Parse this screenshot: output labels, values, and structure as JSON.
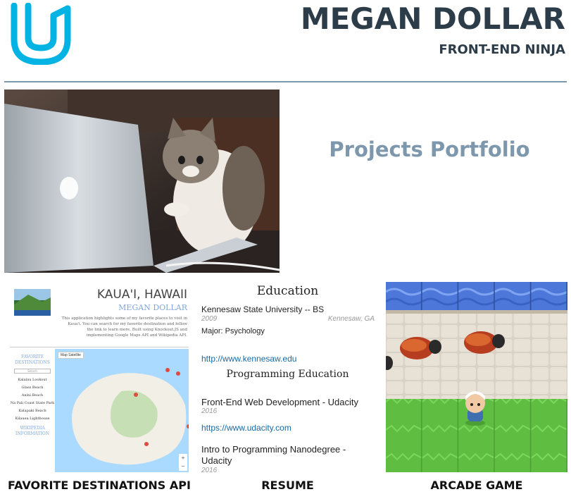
{
  "header": {
    "logo_icon": "udacity-logo-icon",
    "name": "MEGAN DOLLAR",
    "tagline": "FRONT-END NINJA",
    "accent_color": "#2d3c49",
    "logo_color": "#02b3e4"
  },
  "hero": {
    "image": "cat-at-laptop-photo",
    "portfolio_title": "Projects Portfolio",
    "portfolio_color": "#7d97ad"
  },
  "projects": [
    {
      "caption": "FAVORITE DESTINATIONS API",
      "preview": {
        "title": "KAUA'I, HAWAII",
        "author": "MEGAN DOLLAR",
        "description": "This application highlights some of my favorite places to visit in Kaua'i. You can search for my favorite destination and follow the link to learn more. Built using Knockout.JS and implementing Google Maps API and Wikipedia API.",
        "sidebar_heading": "FAVORITE DESTINATIONS",
        "search_label": "Search",
        "places": [
          "Kalalau Lookout",
          "Glass Beach",
          "Anini Beach",
          "Na Pali Coast State Park",
          "Kalapaki Beach",
          "Kilauea Lighthouse"
        ],
        "wiki_heading": "WIKIPEDIA INFORMATION",
        "map_toggle": [
          "Map",
          "Satellite"
        ],
        "zoom_in": "+",
        "zoom_out": "−"
      }
    },
    {
      "caption": "RESUME",
      "preview": {
        "education_heading": "Education",
        "school": "Kennesaw State University -- BS",
        "school_year": "2009",
        "school_location": "Kennesaw, GA",
        "major": "Major: Psychology",
        "school_url": "http://www.kennesaw.edu",
        "online_heading": "Programming Education",
        "course1": "Front-End Web Development - Udacity",
        "course1_year": "2016",
        "course1_url": "https://www.udacity.com",
        "course2_line1": "Intro to Programming Nanodegree -",
        "course2_line2": "Udacity",
        "course2_year": "2016"
      }
    },
    {
      "caption": "ARCADE GAME",
      "preview": {
        "image": "frogger-style-arcade-game-screenshot"
      }
    }
  ]
}
